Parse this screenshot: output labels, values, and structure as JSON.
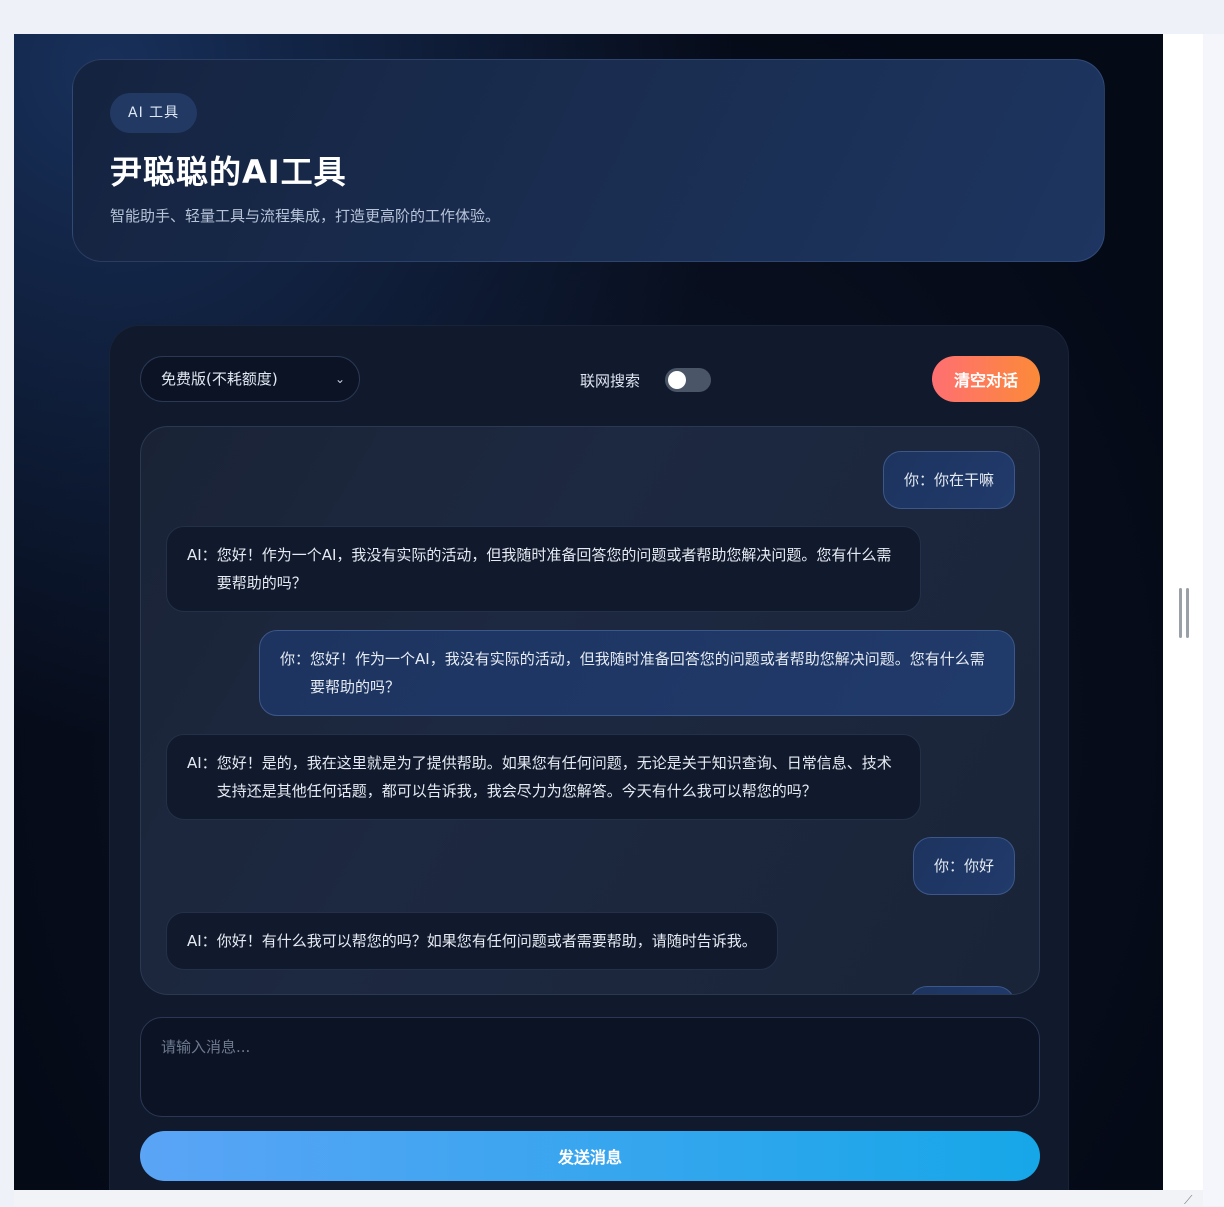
{
  "hero": {
    "badge": "AI 工具",
    "title": "尹聪聪的AI工具",
    "subtitle": "智能助手、轻量工具与流程集成，打造更高阶的工作体验。"
  },
  "toolbar": {
    "model_select_value": "免费版(不耗额度)",
    "web_search_label": "联网搜索",
    "web_search_enabled": false,
    "clear_label": "清空对话"
  },
  "messages": [
    {
      "role": "user",
      "speaker": "你：",
      "text": "你在干嘛"
    },
    {
      "role": "ai",
      "speaker": "AI：",
      "text": "您好！作为一个AI，我没有实际的活动，但我随时准备回答您的问题或者帮助您解决问题。您有什么需要帮助的吗？"
    },
    {
      "role": "user",
      "speaker": "你：",
      "text": "您好！作为一个AI，我没有实际的活动，但我随时准备回答您的问题或者帮助您解决问题。您有什么需要帮助的吗？"
    },
    {
      "role": "ai",
      "speaker": "AI：",
      "text": "您好！是的，我在这里就是为了提供帮助。如果您有任何问题，无论是关于知识查询、日常信息、技术支持还是其他任何话题，都可以告诉我，我会尽力为您解答。今天有什么我可以帮您的吗？"
    },
    {
      "role": "user",
      "speaker": "你：",
      "text": "你好"
    },
    {
      "role": "ai",
      "speaker": "AI：",
      "text": "你好！有什么我可以帮您的吗？如果您有任何问题或者需要帮助，请随时告诉我。"
    }
  ],
  "composer": {
    "placeholder": "请输入消息...",
    "value": "",
    "send_label": "发送消息"
  }
}
